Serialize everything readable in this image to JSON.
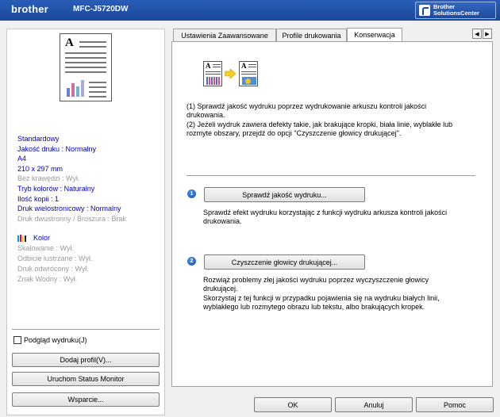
{
  "header": {
    "brand": "brother",
    "model": "MFC-J5720DW",
    "solutions_center": [
      "Brother",
      "SolutionsCenter"
    ]
  },
  "summary": {
    "settings_active": [
      "Standardowy",
      "Jakość druku : Normalny",
      "A4",
      "210 x 297 mm"
    ],
    "setting_borderless": "Bez krawędzi : Wył.",
    "settings_active2": [
      "Tryb kolorów : Naturalny",
      "Ilość kopii : 1",
      "Druk wielostronicowy : Normalny"
    ],
    "setting_duplex": "Druk dwustronny / Broszura : Brak",
    "color_label": "Kolor",
    "settings_inactive": [
      "Skalowanie : Wył.",
      "Odbicie lustrzane : Wył.",
      "Druk odwrócony : Wył.",
      "Znak Wodny : Wył."
    ]
  },
  "left_controls": {
    "preview_label": "Podgląd wydruku(J)",
    "add_profile": "Dodaj profil(V)...",
    "status_monitor": "Uruchom Status Monitor",
    "support": "Wsparcie..."
  },
  "tabs": [
    "Ustawienia Zaawansowane",
    "Profile drukowania",
    "Konserwacja"
  ],
  "active_tab": "Konserwacja",
  "maintenance": {
    "intro_1": "(1) Sprawdź jakość wydruku poprzez wydrukowanie arkuszu kontroli jakości drukowania.",
    "intro_2": "(2) Jeżeli wydruk zawiera defekty takie, jak brakujące kropki, biała linie, wyblakłe lub rozmyte obszary, przejdź do opcji \"Czyszczenie głowicy drukującej\".",
    "step1_number": "1",
    "step1_button": "Sprawdź jakość wydruku...",
    "step1_desc": "Sprawdź efekt wydruku korzystając z funkcji wydruku arkusza kontroli jakości drukowania.",
    "step2_number": "2",
    "step2_button": "Czyszczenie głowicy drukującej...",
    "step2_desc_1": "Rozwiąż problemy złej jakości wydruku poprzez wyczyszczenie głowicy drukującej.",
    "step2_desc_2": "Skorzystaj z tej funkcji w przypadku pojawienia się na wydruku białych linii, wyblakłego lub rozmytego obrazu lub tekstu, albo brakujących kropek."
  },
  "footer": {
    "ok": "OK",
    "cancel": "Anuluj",
    "help": "Pomoc"
  },
  "colors": {
    "banner": "#1f4fa6",
    "setting_active": "#0000c8",
    "setting_inactive": "#9a9a9a"
  }
}
